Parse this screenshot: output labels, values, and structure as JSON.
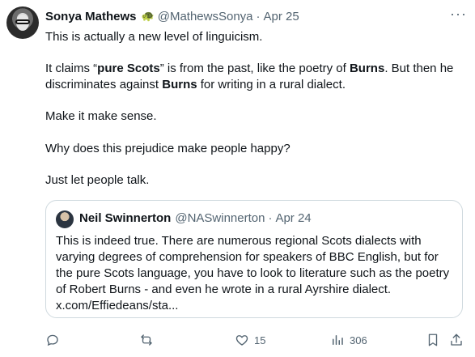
{
  "tweet": {
    "author_name": "Sonya Mathews",
    "author_badge": "turtle",
    "author_handle": "@MathewsSonya",
    "separator": "·",
    "date": "Apr 25",
    "more": "···",
    "p1": "This is actually a new level of linguicism.",
    "p2": {
      "a": "It claims “",
      "b": "pure Scots",
      "c": "” is from the past, like the poetry of ",
      "d": "Burns",
      "e": ". But then he discriminates against ",
      "f": "Burns",
      "g": " for writing in a rural dialect."
    },
    "p3": "Make it make sense.",
    "p4": "Why does this prejudice make people happy?",
    "p5": "Just let people talk."
  },
  "quote": {
    "author_name": "Neil Swinnerton",
    "author_handle": "@NASwinnerton",
    "separator": "·",
    "date": "Apr 24",
    "text": "This is indeed true.  There are numerous regional Scots dialects with varying degrees of comprehension for speakers of BBC English, but for the pure Scots language, you have to look to literature such as the poetry of Robert Burns - and even he wrote in a rural Ayrshire dialect.",
    "link": "x.com/Effiedeans/sta..."
  },
  "actions": {
    "reply_icon": "reply-icon",
    "retweet_icon": "retweet-icon",
    "like_icon": "heart-icon",
    "like_count": "15",
    "views_icon": "views-icon",
    "views_count": "306",
    "bookmark_icon": "bookmark-icon",
    "share_icon": "share-icon"
  },
  "colors": {
    "text": "#0f1419",
    "secondary": "#536471",
    "border": "#cfd9de"
  }
}
